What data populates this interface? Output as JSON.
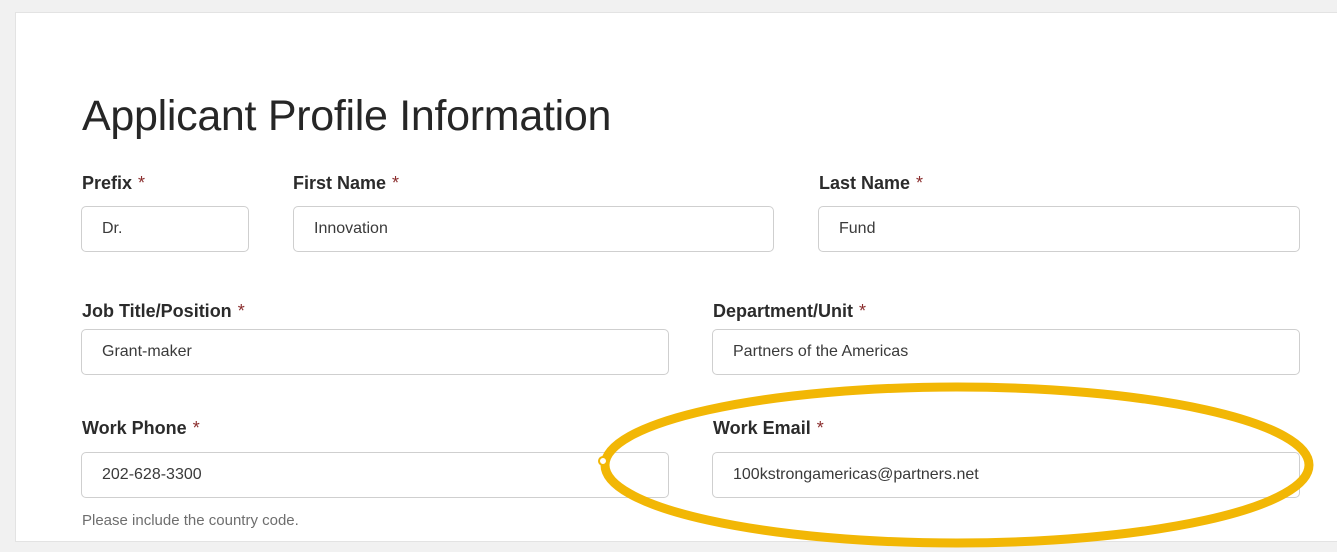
{
  "page_title": "Applicant Profile Information",
  "required_marker": "*",
  "fields": {
    "prefix": {
      "label": "Prefix",
      "value": "Dr."
    },
    "first_name": {
      "label": "First Name",
      "value": "Innovation"
    },
    "last_name": {
      "label": "Last Name",
      "value": "Fund"
    },
    "job_title": {
      "label": "Job Title/Position",
      "value": "Grant-maker"
    },
    "department": {
      "label": "Department/Unit",
      "value": "Partners of the Americas"
    },
    "work_phone": {
      "label": "Work Phone",
      "value": "202-628-3300",
      "help": "Please include the country code."
    },
    "work_email": {
      "label": "Work Email",
      "value": "100kstrongamericas@partners.net"
    }
  },
  "colors": {
    "required": "#8a2d2d",
    "highlight_ring": "#f2b705"
  }
}
